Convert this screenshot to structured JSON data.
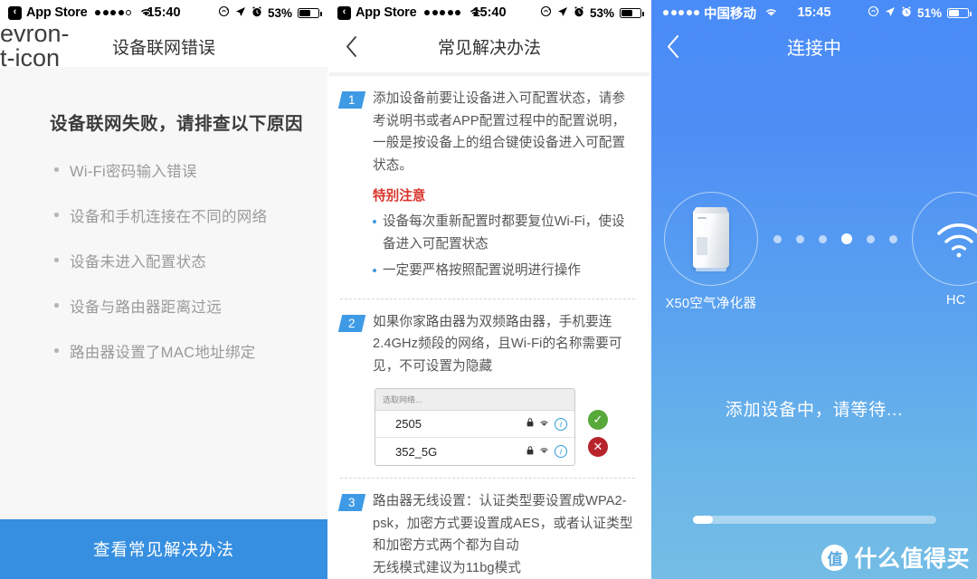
{
  "panel1": {
    "status_bar": {
      "back_glyph": "‹",
      "app_name": "App Store",
      "signal_dots": [
        "full",
        "full",
        "full",
        "full",
        "empty"
      ],
      "wifi_icon": "wifi-icon",
      "time": "15:40",
      "rotation_lock_icon": "rotation-lock-icon",
      "location_icon": "location-arrow-icon",
      "alarm_icon": "alarm-clock-icon",
      "battery_percent": "53%",
      "battery_level": 53
    },
    "nav": {
      "back_icon": "chevron-left-icon",
      "title": "设备联网错误"
    },
    "heading": "设备联网失败，请排查以下原因",
    "reasons": [
      "Wi-Fi密码输入错误",
      "设备和手机连接在不同的网络",
      "设备未进入配置状态",
      "设备与路由器距离过远",
      "路由器设置了MAC地址绑定"
    ],
    "cta_label": "查看常见解决办法",
    "cta_color": "#368fe0"
  },
  "panel2": {
    "status_bar": {
      "back_glyph": "‹",
      "app_name": "App Store",
      "signal_dots": [
        "full",
        "full",
        "full",
        "full",
        "full"
      ],
      "wifi_icon": "wifi-icon",
      "time": "15:40",
      "battery_percent": "53%",
      "battery_level": 53
    },
    "nav": {
      "back_icon": "chevron-left-icon",
      "title": "常见解决办法"
    },
    "steps": [
      {
        "number": "1",
        "text": "添加设备前要让设备进入可配置状态，请参考说明书或者APP配置过程中的配置说明，一般是按设备上的组合键使设备进入可配置状态。",
        "notice_title": "特别注意",
        "notice_items": [
          "设备每次重新配置时都要复位Wi-Fi，使设备进入可配置状态",
          "一定要严格按照配置说明进行操作"
        ]
      },
      {
        "number": "2",
        "text": "如果你家路由器为双频路由器，手机要连2.4GHz频段的网络，且Wi-Fi的名称需要可见，不可设置为隐藏"
      },
      {
        "number": "3",
        "text": "路由器无线设置：认证类型要设置成WPA2-psk，加密方式要设置成AES，或者认证类型和加密方式两个都为自动",
        "text2": "无线模式建议为11bg模式"
      }
    ],
    "wifi_picker": {
      "header": "选取网络...",
      "rows": [
        {
          "ssid": "2505",
          "lock_icon": "lock-icon",
          "signal_icon": "wifi-icon",
          "info_icon": "info-icon",
          "mark": "✓",
          "mark_type": "ok"
        },
        {
          "ssid": "352_5G",
          "lock_icon": "lock-icon",
          "signal_icon": "wifi-icon",
          "info_icon": "info-icon",
          "mark": "✕",
          "mark_type": "no"
        }
      ]
    }
  },
  "panel3": {
    "status_bar": {
      "signal_dots": [
        "full",
        "full",
        "full",
        "full",
        "full"
      ],
      "carrier": "中国移动",
      "wifi_icon": "wifi-icon",
      "time": "15:45",
      "battery_percent": "51%",
      "battery_level": 51
    },
    "nav": {
      "back_icon": "chevron-left-icon",
      "title": "连接中"
    },
    "device": {
      "icon": "air-purifier-icon",
      "label": "X50空气净化器"
    },
    "router": {
      "icon": "wifi-icon",
      "label": "HC"
    },
    "connection_dots": {
      "count": 6,
      "active_index": 3
    },
    "status_text": "添加设备中，请等待...",
    "progress_percent": 8,
    "watermark": {
      "badge": "值",
      "text": "什么值得买"
    },
    "bg_top_color": "#4a8cf7",
    "bg_bottom_color": "#74bde6"
  }
}
